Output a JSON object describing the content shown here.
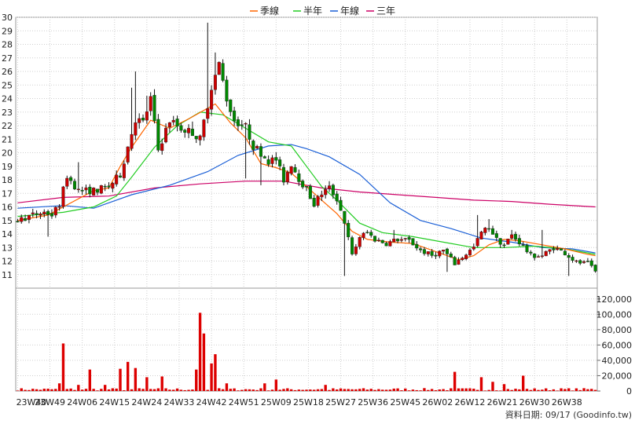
{
  "chart_data": {
    "type": "candlestick",
    "legend": [
      {
        "name": "季線",
        "color": "#ff6600"
      },
      {
        "name": "半年",
        "color": "#22cc22"
      },
      {
        "name": "年線",
        "color": "#1a5fd6"
      },
      {
        "name": "三年",
        "color": "#cc0066"
      }
    ],
    "up_color": "#cc0000",
    "down_color": "#008800",
    "price_axis": {
      "ylim": [
        10,
        30
      ],
      "ticks": [
        11,
        12,
        13,
        14,
        15,
        16,
        17,
        18,
        19,
        20,
        21,
        22,
        23,
        24,
        25,
        26,
        27,
        28,
        29,
        30
      ]
    },
    "volume_axis": {
      "ylim": [
        0,
        130000
      ],
      "ticks": [
        0,
        20000,
        40000,
        60000,
        80000,
        100000,
        120000
      ],
      "tick_labels": [
        "0",
        "20,000",
        "40,000",
        "60,000",
        "80,000",
        "100,000",
        "120,000"
      ]
    },
    "x_labels": [
      "23W40",
      "23W49",
      "24W06",
      "24W15",
      "24W24",
      "24W33",
      "24W42",
      "24W51",
      "25W09",
      "25W18",
      "25W27",
      "25W36",
      "25W45",
      "26W02",
      "26W12",
      "26W21",
      "26W30",
      "26W38"
    ],
    "footer": "資料日期: 09/17  (Goodinfo.tw)",
    "price_waypoints": [
      [
        0,
        15.0
      ],
      [
        4,
        15.4
      ],
      [
        7,
        15.6
      ],
      [
        9,
        15.4
      ],
      [
        11,
        16.2
      ],
      [
        13,
        18.3
      ],
      [
        16,
        17.2
      ],
      [
        20,
        17.2
      ],
      [
        24,
        17.5
      ],
      [
        27,
        18.4
      ],
      [
        31,
        22.5
      ],
      [
        33,
        22.2
      ],
      [
        35,
        24.0
      ],
      [
        37,
        20.2
      ],
      [
        40,
        22.4
      ],
      [
        43,
        21.8
      ],
      [
        46,
        21.5
      ],
      [
        48,
        21.0
      ],
      [
        51,
        24.9
      ],
      [
        53,
        26.5
      ],
      [
        55,
        24.0
      ],
      [
        57,
        22.4
      ],
      [
        60,
        21.9
      ],
      [
        62,
        20.5
      ],
      [
        64,
        20.0
      ],
      [
        66,
        19.4
      ],
      [
        68,
        19.5
      ],
      [
        70,
        18.0
      ],
      [
        72,
        19.2
      ],
      [
        74,
        18.1
      ],
      [
        76,
        17.3
      ],
      [
        78,
        16.2
      ],
      [
        80,
        17.0
      ],
      [
        82,
        17.4
      ],
      [
        84,
        16.6
      ],
      [
        86,
        14.9
      ],
      [
        88,
        12.4
      ],
      [
        90,
        13.8
      ],
      [
        92,
        14.1
      ],
      [
        94,
        13.6
      ],
      [
        97,
        13.3
      ],
      [
        100,
        13.6
      ],
      [
        103,
        13.5
      ],
      [
        106,
        12.8
      ],
      [
        109,
        12.4
      ],
      [
        112,
        12.8
      ],
      [
        115,
        11.8
      ],
      [
        117,
        12.3
      ],
      [
        120,
        13.0
      ],
      [
        122,
        14.1
      ],
      [
        124,
        14.5
      ],
      [
        126,
        13.6
      ],
      [
        128,
        13.2
      ],
      [
        130,
        13.9
      ],
      [
        132,
        13.4
      ],
      [
        135,
        12.4
      ],
      [
        138,
        12.4
      ],
      [
        141,
        13.0
      ],
      [
        144,
        12.6
      ],
      [
        147,
        11.9
      ],
      [
        150,
        11.8
      ],
      [
        152,
        11.2
      ]
    ],
    "high_spikes": [
      [
        16,
        19.3
      ],
      [
        30,
        24.8
      ],
      [
        31,
        26.0
      ],
      [
        34,
        24.2
      ],
      [
        46,
        22.3
      ],
      [
        50,
        29.6
      ],
      [
        52,
        27.4
      ],
      [
        57,
        23.3
      ],
      [
        62,
        20.6
      ],
      [
        66,
        19.8
      ],
      [
        76,
        17.5
      ],
      [
        85,
        15.0
      ],
      [
        99,
        14.3
      ],
      [
        121,
        15.4
      ],
      [
        124,
        15.1
      ],
      [
        130,
        14.3
      ],
      [
        138,
        14.3
      ]
    ],
    "low_spikes": [
      [
        8,
        13.8
      ],
      [
        60,
        18.1
      ],
      [
        64,
        17.6
      ],
      [
        70,
        17.7
      ],
      [
        86,
        10.9
      ],
      [
        113,
        11.2
      ],
      [
        145,
        10.9
      ]
    ],
    "ma_quarter": [
      [
        0,
        15.0
      ],
      [
        8,
        15.4
      ],
      [
        12,
        16.0
      ],
      [
        20,
        17.2
      ],
      [
        24,
        17.4
      ],
      [
        27,
        19.0
      ],
      [
        30,
        20.4
      ],
      [
        35,
        22.4
      ],
      [
        40,
        21.8
      ],
      [
        45,
        22.5
      ],
      [
        52,
        23.6
      ],
      [
        56,
        22.2
      ],
      [
        60,
        21.1
      ],
      [
        64,
        19.2
      ],
      [
        68,
        18.9
      ],
      [
        72,
        18.5
      ],
      [
        76,
        17.5
      ],
      [
        80,
        16.5
      ],
      [
        84,
        15.5
      ],
      [
        88,
        14.2
      ],
      [
        92,
        13.6
      ],
      [
        98,
        13.4
      ],
      [
        104,
        13.3
      ],
      [
        110,
        12.7
      ],
      [
        116,
        12.1
      ],
      [
        120,
        12.4
      ],
      [
        124,
        13.2
      ],
      [
        128,
        13.6
      ],
      [
        132,
        13.5
      ],
      [
        138,
        13.2
      ],
      [
        144,
        12.9
      ],
      [
        150,
        12.5
      ],
      [
        152,
        12.4
      ]
    ],
    "ma_half": [
      [
        0,
        15.3
      ],
      [
        12,
        15.6
      ],
      [
        20,
        16.0
      ],
      [
        26,
        16.8
      ],
      [
        30,
        18.2
      ],
      [
        36,
        20.4
      ],
      [
        42,
        22.0
      ],
      [
        48,
        23.0
      ],
      [
        54,
        22.8
      ],
      [
        60,
        21.8
      ],
      [
        66,
        20.8
      ],
      [
        72,
        20.5
      ],
      [
        76,
        19.0
      ],
      [
        80,
        17.5
      ],
      [
        84,
        16.5
      ],
      [
        90,
        14.8
      ],
      [
        96,
        14.1
      ],
      [
        104,
        13.8
      ],
      [
        112,
        13.4
      ],
      [
        120,
        13.0
      ],
      [
        128,
        13.0
      ],
      [
        136,
        13.1
      ],
      [
        144,
        12.9
      ],
      [
        152,
        12.5
      ]
    ],
    "ma_year": [
      [
        0,
        15.9
      ],
      [
        12,
        16.1
      ],
      [
        20,
        15.9
      ],
      [
        30,
        16.9
      ],
      [
        40,
        17.6
      ],
      [
        50,
        18.6
      ],
      [
        58,
        19.8
      ],
      [
        66,
        20.5
      ],
      [
        72,
        20.6
      ],
      [
        76,
        20.3
      ],
      [
        82,
        19.7
      ],
      [
        90,
        18.4
      ],
      [
        98,
        16.3
      ],
      [
        106,
        15.0
      ],
      [
        114,
        14.4
      ],
      [
        122,
        13.7
      ],
      [
        130,
        13.4
      ],
      [
        138,
        13.0
      ],
      [
        146,
        12.9
      ],
      [
        152,
        12.6
      ]
    ],
    "ma_three": [
      [
        0,
        16.3
      ],
      [
        12,
        16.7
      ],
      [
        24,
        16.8
      ],
      [
        36,
        17.4
      ],
      [
        48,
        17.7
      ],
      [
        60,
        17.9
      ],
      [
        70,
        17.9
      ],
      [
        80,
        17.4
      ],
      [
        90,
        17.1
      ],
      [
        100,
        16.9
      ],
      [
        110,
        16.7
      ],
      [
        120,
        16.5
      ],
      [
        130,
        16.4
      ],
      [
        140,
        16.2
      ],
      [
        152,
        16.0
      ]
    ],
    "volume_spikes": [
      [
        11,
        10000
      ],
      [
        12,
        62000
      ],
      [
        16,
        8000
      ],
      [
        19,
        28000
      ],
      [
        23,
        8000
      ],
      [
        27,
        29000
      ],
      [
        29,
        38000
      ],
      [
        31,
        30000
      ],
      [
        34,
        18000
      ],
      [
        38,
        19000
      ],
      [
        47,
        28000
      ],
      [
        48,
        102000
      ],
      [
        49,
        75000
      ],
      [
        51,
        36000
      ],
      [
        52,
        48000
      ],
      [
        55,
        10000
      ],
      [
        65,
        10000
      ],
      [
        68,
        15000
      ],
      [
        81,
        8000
      ],
      [
        115,
        25000
      ],
      [
        122,
        18000
      ],
      [
        125,
        12000
      ],
      [
        128,
        9000
      ],
      [
        133,
        20000
      ]
    ]
  }
}
